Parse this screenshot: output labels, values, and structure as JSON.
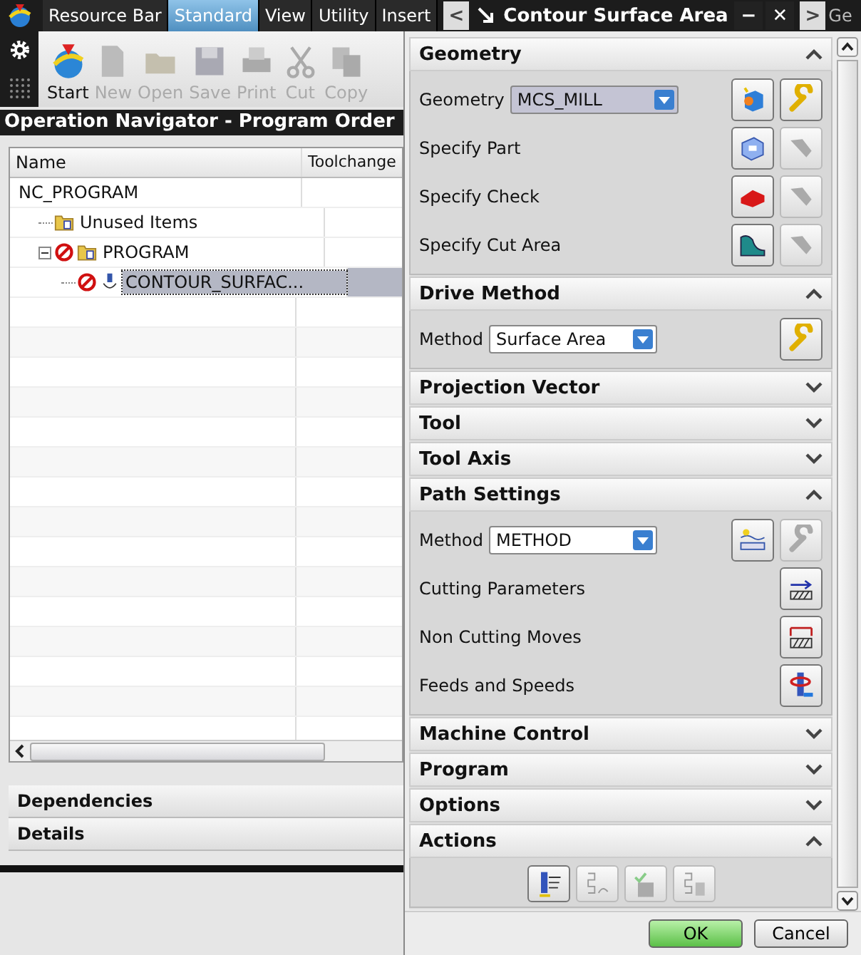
{
  "app_tabs": [
    {
      "label": "Resource Bar",
      "selected": false
    },
    {
      "label": "Standard",
      "selected": true
    },
    {
      "label": "View",
      "selected": false
    },
    {
      "label": "Utility",
      "selected": false
    },
    {
      "label": "Insert",
      "selected": false
    }
  ],
  "dialog_strip": {
    "back": "<",
    "title": "Contour Surface Area",
    "minimize": "−",
    "close": "✕",
    "forward": ">",
    "next_tab": "Ge"
  },
  "toolbar": [
    {
      "label": "Start",
      "kind": "start",
      "disabled": false
    },
    {
      "label": "New",
      "kind": "new",
      "disabled": true
    },
    {
      "label": "Open",
      "kind": "open",
      "disabled": true
    },
    {
      "label": "Save",
      "kind": "save",
      "disabled": true
    },
    {
      "label": "Print",
      "kind": "print",
      "disabled": true
    },
    {
      "label": "Cut",
      "kind": "cut",
      "disabled": true
    },
    {
      "label": "Copy",
      "kind": "copy",
      "disabled": true
    }
  ],
  "navigator": {
    "title": "Operation Navigator - Program Order",
    "columns": [
      "Name",
      "Toolchange"
    ],
    "tree": [
      {
        "label": "NC_PROGRAM",
        "selected": false,
        "children": [
          {
            "label": "Unused Items",
            "kind": "group",
            "selected": false
          },
          {
            "label": "PROGRAM",
            "kind": "group",
            "blocked": true,
            "expanded": true,
            "selected": false,
            "children": [
              {
                "label": "CONTOUR_SURFAC...",
                "kind": "operation",
                "blocked": true,
                "selected": true
              }
            ]
          }
        ]
      }
    ]
  },
  "panels": [
    {
      "title": "Dependencies"
    },
    {
      "title": "Details"
    }
  ],
  "dialog": {
    "sections": [
      {
        "title": "Geometry",
        "expanded": true,
        "rows": [
          {
            "kind": "select",
            "label": "Geometry",
            "value": "MCS_MILL",
            "focused": true,
            "buttons": [
              {
                "kind": "cube",
                "disabled": false
              },
              {
                "kind": "wrench",
                "disabled": false
              }
            ]
          },
          {
            "kind": "buttons",
            "label": "Specify Part",
            "buttons": [
              {
                "kind": "part",
                "disabled": false
              },
              {
                "kind": "torch",
                "disabled": true
              }
            ]
          },
          {
            "kind": "buttons",
            "label": "Specify Check",
            "buttons": [
              {
                "kind": "check",
                "disabled": false
              },
              {
                "kind": "torch",
                "disabled": true
              }
            ]
          },
          {
            "kind": "buttons",
            "label": "Specify Cut Area",
            "buttons": [
              {
                "kind": "area",
                "disabled": false
              },
              {
                "kind": "torch",
                "disabled": true
              }
            ]
          }
        ]
      },
      {
        "title": "Drive Method",
        "expanded": true,
        "rows": [
          {
            "kind": "select",
            "label": "Method",
            "value": "Surface Area",
            "focused": false,
            "buttons": [
              {
                "kind": "wrench",
                "disabled": false
              }
            ]
          }
        ]
      },
      {
        "title": "Projection Vector",
        "expanded": false
      },
      {
        "title": "Tool",
        "expanded": false
      },
      {
        "title": "Tool Axis",
        "expanded": false
      },
      {
        "title": "Path Settings",
        "expanded": true,
        "rows": [
          {
            "kind": "select",
            "label": "Method",
            "value": "METHOD",
            "focused": false,
            "buttons": [
              {
                "kind": "method",
                "disabled": false
              },
              {
                "kind": "wrench",
                "disabled": true
              }
            ]
          },
          {
            "kind": "buttons",
            "label": "Cutting Parameters",
            "buttons": [
              {
                "kind": "cutparams",
                "disabled": false
              }
            ]
          },
          {
            "kind": "buttons",
            "label": "Non Cutting Moves",
            "buttons": [
              {
                "kind": "noncut",
                "disabled": false
              }
            ]
          },
          {
            "kind": "buttons",
            "label": "Feeds and Speeds",
            "buttons": [
              {
                "kind": "feeds",
                "disabled": false
              }
            ]
          }
        ]
      },
      {
        "title": "Machine Control",
        "expanded": false
      },
      {
        "title": "Program",
        "expanded": false
      },
      {
        "title": "Options",
        "expanded": false
      },
      {
        "title": "Actions",
        "expanded": true,
        "rows": [
          {
            "kind": "icons",
            "buttons": [
              {
                "kind": "generate",
                "disabled": false
              },
              {
                "kind": "replay",
                "disabled": true
              },
              {
                "kind": "verify",
                "disabled": true
              },
              {
                "kind": "list",
                "disabled": true
              }
            ]
          }
        ]
      }
    ],
    "buttons": [
      {
        "label": "OK",
        "kind": "primary"
      },
      {
        "label": "Cancel",
        "kind": "secondary"
      }
    ]
  }
}
